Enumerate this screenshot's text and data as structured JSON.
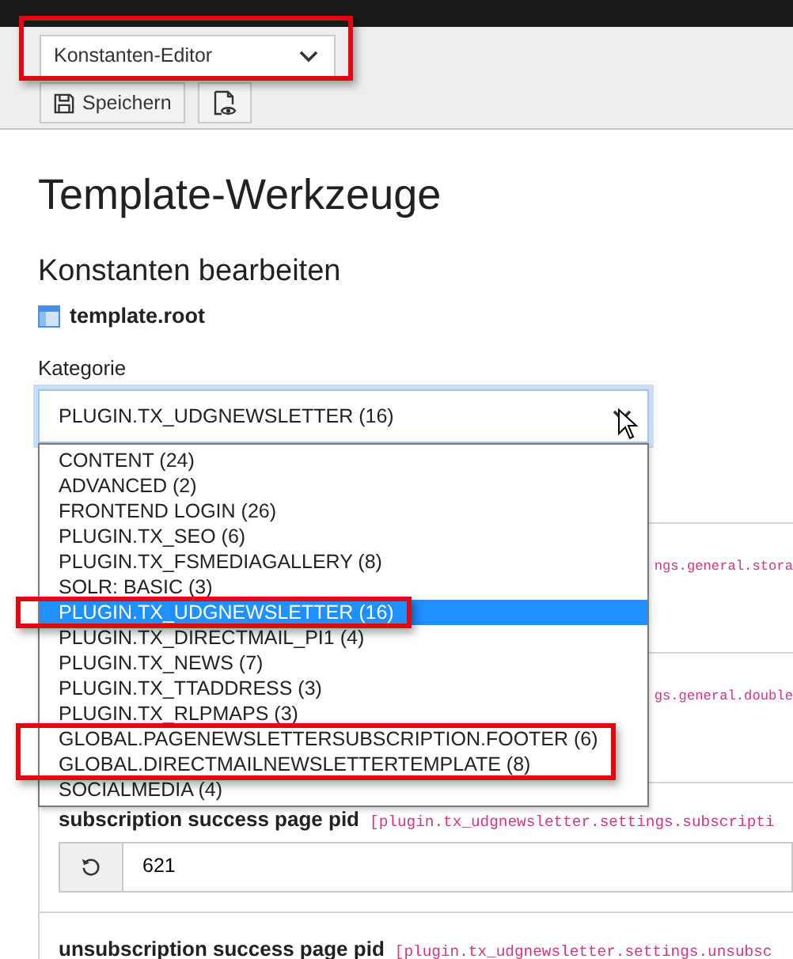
{
  "module_menu": {
    "value": "Konstanten-Editor",
    "highlighted": true
  },
  "toolbar_buttons": [
    {
      "kind": "save",
      "label": "Speichern"
    },
    {
      "kind": "view"
    }
  ],
  "title": "Template-Werkzeuge",
  "subtitle": "Konstanten bearbeiten",
  "template": "template.root",
  "category": {
    "label": "Kategorie",
    "value": "PLUGIN.TX_UDGNEWSLETTER (16)",
    "expanded": true,
    "options": [
      {
        "label": "CONTENT (24)",
        "selected": false,
        "highlighted": false
      },
      {
        "label": "ADVANCED (2)",
        "selected": false,
        "highlighted": false
      },
      {
        "label": "FRONTEND LOGIN (26)",
        "selected": false,
        "highlighted": false
      },
      {
        "label": "PLUGIN.TX_SEO (6)",
        "selected": false,
        "highlighted": false
      },
      {
        "label": "PLUGIN.TX_FSMEDIAGALLERY (8)",
        "selected": false,
        "highlighted": false
      },
      {
        "label": "SOLR: BASIC (3)",
        "selected": false,
        "highlighted": false
      },
      {
        "label": "PLUGIN.TX_UDGNEWSLETTER (16)",
        "selected": true,
        "highlighted": true
      },
      {
        "label": "PLUGIN.TX_DIRECTMAIL_PI1 (4)",
        "selected": false,
        "highlighted": false
      },
      {
        "label": "PLUGIN.TX_NEWS (7)",
        "selected": false,
        "highlighted": false
      },
      {
        "label": "PLUGIN.TX_TTADDRESS (3)",
        "selected": false,
        "highlighted": false
      },
      {
        "label": "PLUGIN.TX_RLPMAPS (3)",
        "selected": false,
        "highlighted": false
      },
      {
        "label": "GLOBAL.PAGENEWSLETTERSUBSCRIPTION.FOOTER (6)",
        "selected": false,
        "highlighted": true
      },
      {
        "label": "GLOBAL.DIRECTMAILNEWSLETTERTEMPLATE (8)",
        "selected": false,
        "highlighted": true
      },
      {
        "label": "SOCIALMEDIA (4)",
        "selected": false,
        "highlighted": false
      }
    ]
  },
  "constants": [
    {
      "kind": "covered",
      "code": "ngs.general.stora"
    },
    {
      "kind": "covered",
      "code": "gs.general.double"
    },
    {
      "kind": "field",
      "label": "subscription success page pid",
      "code": "[plugin.tx_udgnewsletter.settings.subscripti",
      "value": "621"
    },
    {
      "kind": "field",
      "label": "unsubscription success page pid",
      "code": "[plugin.tx_udgnewsletter.settings.unsubsc"
    }
  ]
}
